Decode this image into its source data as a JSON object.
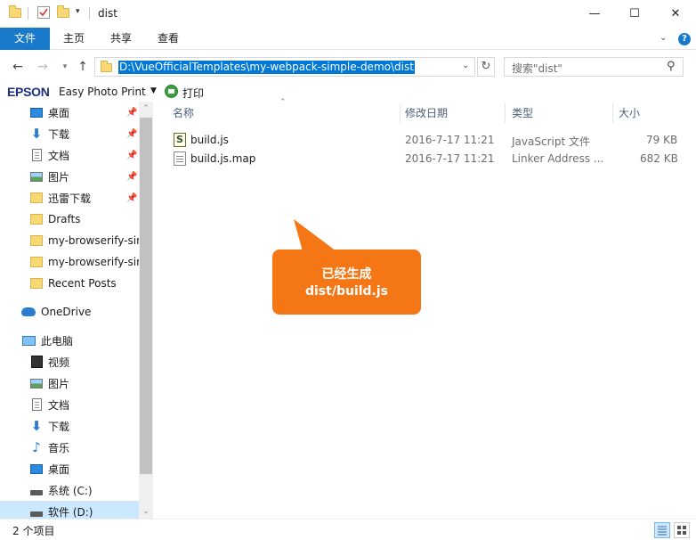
{
  "window": {
    "title": "dist",
    "minimize": "—",
    "maximize": "☐",
    "close": "✕"
  },
  "ribbon": {
    "tabs": [
      "文件",
      "主页",
      "共享",
      "查看"
    ],
    "help": "?"
  },
  "address": {
    "path": "D:\\VueOfficialTemplates\\my-webpack-simple-demo\\dist",
    "search_placeholder": "搜索\"dist\""
  },
  "epson": {
    "logo": "EPSON",
    "app": "Easy Photo Print",
    "print": "打印"
  },
  "nav": {
    "items": [
      {
        "label": "桌面",
        "icon": "desktop-icon",
        "pinned": true
      },
      {
        "label": "下载",
        "icon": "download-icon",
        "pinned": true
      },
      {
        "label": "文档",
        "icon": "document-icon",
        "pinned": true
      },
      {
        "label": "图片",
        "icon": "picture-icon",
        "pinned": true
      },
      {
        "label": "迅雷下载",
        "icon": "folder-icon",
        "pinned": true
      },
      {
        "label": "Drafts",
        "icon": "folder-icon",
        "pinned": false
      },
      {
        "label": "my-browserify-sir",
        "icon": "folder-icon",
        "pinned": false
      },
      {
        "label": "my-browserify-sir",
        "icon": "folder-icon",
        "pinned": false
      },
      {
        "label": "Recent Posts",
        "icon": "folder-icon",
        "pinned": false
      },
      {
        "label": "OneDrive",
        "icon": "cloud-icon",
        "pinned": false
      },
      {
        "label": "此电脑",
        "icon": "computer-icon",
        "pinned": false
      },
      {
        "label": "视频",
        "icon": "video-icon",
        "pinned": false
      },
      {
        "label": "图片",
        "icon": "picture-icon",
        "pinned": false
      },
      {
        "label": "文档",
        "icon": "document-icon",
        "pinned": false
      },
      {
        "label": "下载",
        "icon": "download-icon",
        "pinned": false
      },
      {
        "label": "音乐",
        "icon": "music-icon",
        "pinned": false
      },
      {
        "label": "桌面",
        "icon": "desktop-icon",
        "pinned": false
      },
      {
        "label": "系统 (C:)",
        "icon": "drive-icon",
        "pinned": false
      },
      {
        "label": "软件 (D:)",
        "icon": "drive-icon",
        "pinned": false
      }
    ]
  },
  "files": {
    "columns": [
      "名称",
      "修改日期",
      "类型",
      "大小"
    ],
    "rows": [
      {
        "name": "build.js",
        "date": "2016-7-17 11:21",
        "type": "JavaScript 文件",
        "size": "79 KB",
        "icon": "javascript-file-icon"
      },
      {
        "name": "build.js.map",
        "date": "2016-7-17 11:21",
        "type": "Linker Address ...",
        "size": "682 KB",
        "icon": "map-file-icon"
      }
    ]
  },
  "callout": {
    "line1": "已经生成",
    "line2": "dist/build.js",
    "color": "#f57614"
  },
  "status": {
    "count": "2 个项目"
  },
  "colors": {
    "accent": "#1979ca",
    "selection": "#0078d7"
  }
}
